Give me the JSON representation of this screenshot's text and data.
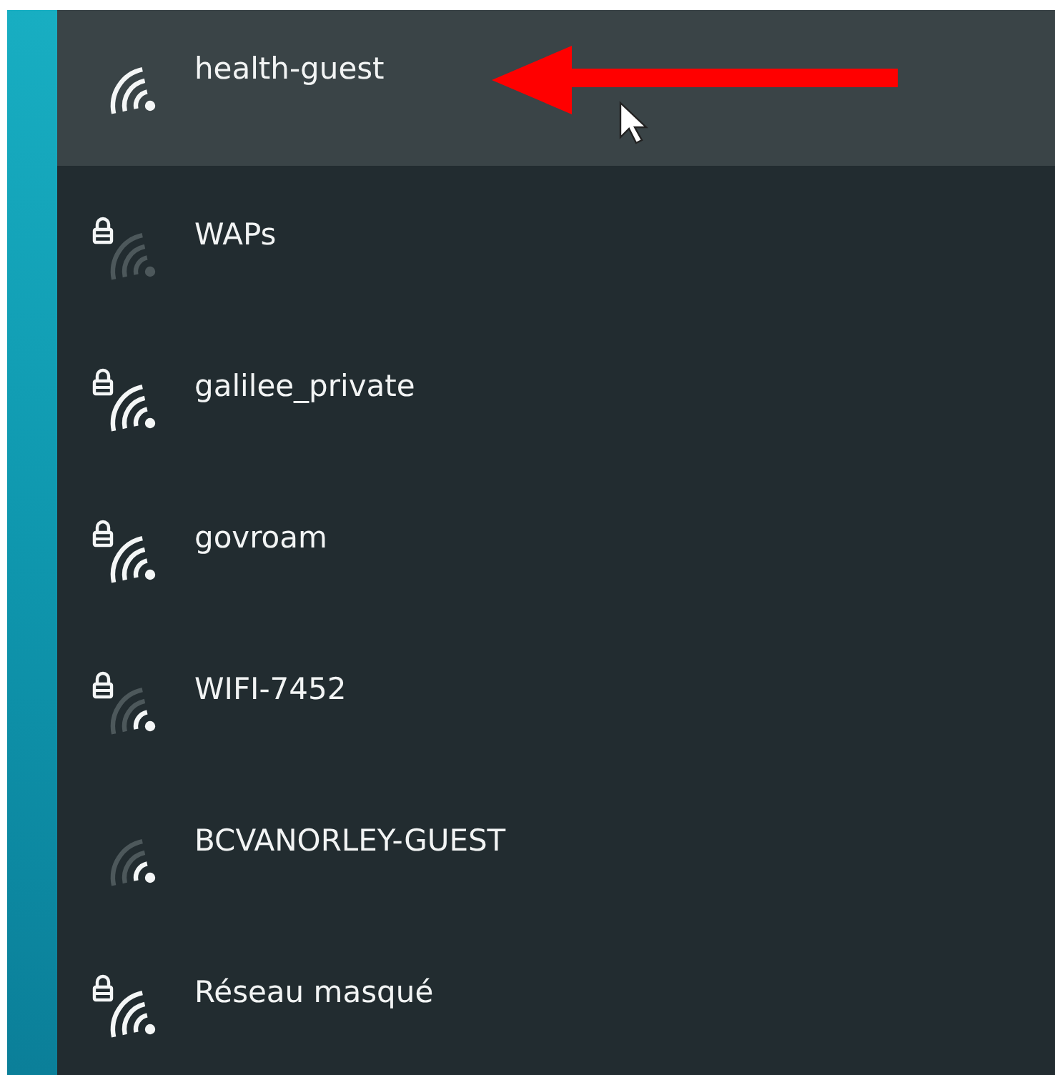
{
  "networks": [
    {
      "name": "health-guest",
      "secured": false,
      "kind": "strong",
      "selected": true
    },
    {
      "name": "WAPs",
      "secured": true,
      "kind": "none",
      "selected": false
    },
    {
      "name": "galilee_private",
      "secured": true,
      "kind": "strong",
      "selected": false
    },
    {
      "name": "govroam",
      "secured": true,
      "kind": "strong",
      "selected": false
    },
    {
      "name": "WIFI-7452",
      "secured": true,
      "kind": "weak",
      "selected": false
    },
    {
      "name": "BCVANORLEY-GUEST",
      "secured": false,
      "kind": "weak",
      "selected": false
    },
    {
      "name": "Réseau masqué",
      "secured": true,
      "kind": "strong",
      "selected": false
    }
  ]
}
